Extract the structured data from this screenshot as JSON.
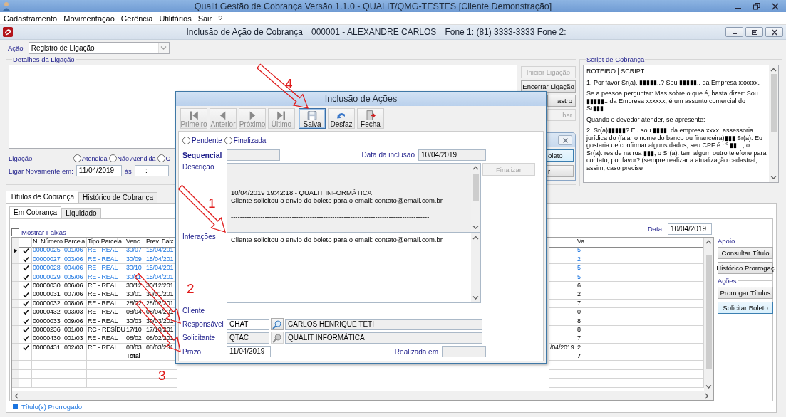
{
  "window": {
    "title": "Qualit Gestão de Cobrança Versão 1.1.0 - QUALIT/QMG-TESTES [Cliente Demonstração]"
  },
  "menu": [
    "Cadastramento",
    "Movimentação",
    "Gerência",
    "Utilitários",
    "Sair",
    "?"
  ],
  "form": {
    "title": "Inclusão de Ação de Cobrança",
    "client": "000001 - ALEXANDRE CARLOS",
    "phones": "Fone 1: (81) 3333-3333 Fone 2:"
  },
  "action": {
    "label": "Ação",
    "value": "Registro de Ligação"
  },
  "call_details": {
    "title": "Detalhes da Ligação",
    "buttons": [
      {
        "label": "Iniciar Ligação",
        "disabled": true
      },
      {
        "label": "Encerrar Ligação",
        "disabled": false
      },
      {
        "label": "astro",
        "disabled": false
      },
      {
        "label": "har",
        "disabled": true
      }
    ],
    "call_label": "Ligação",
    "call_options": [
      {
        "label": "Atendida",
        "selected": false
      },
      {
        "label": "Não Atendida",
        "selected": false
      },
      {
        "label": "O",
        "selected": false
      }
    ],
    "recall_label": "Ligar Novamente em:",
    "recall_date": "11/04/2019",
    "at_label": "às",
    "recall_time": ":"
  },
  "script": {
    "title": "Script de Cobrança",
    "paragraphs": [
      "ROTEIRO | SCRIPT",
      "1. Por favor Sr(a). ▮▮▮▮▮..? Sou ▮▮▮▮▮.. da Empresa xxxxxx.",
      "Se a pessoa perguntar: Mas sobre o que é, basta dizer: Sou ▮▮▮▮▮.. da Empresa xxxxxx, é um assunto comercial do Sr▮▮▮..",
      "Quando o devedor atender, se apresente:",
      "2. Sr(a)▮▮▮▮▮? Eu sou ▮▮▮▮. da empresa xxxx, assessoria jurídica do (falar o nome do banco ou financeira)▮▮▮ Sr(a). Eu gostaria de confirmar alguns dados, seu CPF é nº ▮▮..., o Sr(a). reside na rua ▮▮▮, o Sr(a). tem algum outro telefone para contato, por favor? (sempre realizar a atualização cadastral, assim, caso precise"
    ]
  },
  "tabs": [
    {
      "label": "Títulos de Cobrança",
      "selected": true
    },
    {
      "label": "Histórico de Cobrança",
      "selected": false
    }
  ],
  "subtabs": [
    {
      "label": "Em Cobrança",
      "selected": true
    },
    {
      "label": "Liquidado",
      "selected": false
    }
  ],
  "show_ranges": {
    "label": "Mostrar Faixas",
    "checked": false
  },
  "date": {
    "label": "Data",
    "value": "10/04/2019"
  },
  "table": {
    "columns": [
      "N. Número",
      "Parcela",
      "Tipo Parcela",
      "Venc.",
      "Prev. Baix",
      "Va"
    ],
    "rows": [
      {
        "current": true,
        "checked": true,
        "extended": true,
        "cells": [
          "00000025",
          "001/06",
          "RE - REAL",
          "30/07",
          "15/04/201"
        ],
        "va": "5"
      },
      {
        "current": false,
        "checked": true,
        "extended": true,
        "cells": [
          "00000027",
          "003/06",
          "RE - REAL",
          "30/09",
          "15/04/201"
        ],
        "va": "2"
      },
      {
        "current": false,
        "checked": true,
        "extended": true,
        "cells": [
          "00000028",
          "004/06",
          "RE - REAL",
          "30/10",
          "15/04/201"
        ],
        "va": "5"
      },
      {
        "current": false,
        "checked": true,
        "extended": true,
        "cells": [
          "00000029",
          "005/06",
          "RE - REAL",
          "30/11",
          "15/04/201"
        ],
        "va": "5"
      },
      {
        "current": false,
        "checked": true,
        "extended": false,
        "cells": [
          "00000030",
          "006/06",
          "RE - REAL",
          "30/12",
          "30/12/201"
        ],
        "va": "6"
      },
      {
        "current": false,
        "checked": true,
        "extended": false,
        "cells": [
          "00000031",
          "007/06",
          "RE - REAL",
          "30/01",
          "30/01/201"
        ],
        "va": "2"
      },
      {
        "current": false,
        "checked": true,
        "extended": false,
        "cells": [
          "00000032",
          "008/06",
          "RE - REAL",
          "28/02",
          "28/02/201"
        ],
        "va": "7"
      },
      {
        "current": false,
        "checked": true,
        "extended": false,
        "cells": [
          "00000432",
          "003/03",
          "RE - REAL",
          "08/04",
          "08/04/201"
        ],
        "va": "0"
      },
      {
        "current": false,
        "checked": true,
        "extended": false,
        "cells": [
          "00000033",
          "009/06",
          "RE - REAL",
          "30/03",
          "30/03/201"
        ],
        "va": "8"
      },
      {
        "current": false,
        "checked": true,
        "extended": false,
        "cells": [
          "00000236",
          "001/00",
          "RC - RESÍDU",
          "17/10",
          "17/10/201"
        ],
        "va": "8"
      },
      {
        "current": false,
        "checked": true,
        "extended": false,
        "cells": [
          "00000430",
          "001/03",
          "RE - REAL",
          "08/02",
          "08/02/201"
        ],
        "va": "7"
      },
      {
        "current": false,
        "checked": true,
        "extended": false,
        "cells": [
          "00000431",
          "002/03",
          "RE - REAL",
          "08/03",
          "08/03/201"
        ],
        "column_8": "/04/2019",
        "va": "2"
      }
    ],
    "total_label": "Total",
    "total_va": "7"
  },
  "side_panel": [
    {
      "title": "Apoio",
      "buttons": [
        {
          "label": "Consultar Título",
          "focused": false
        },
        {
          "label": "Histórico Prorrogaç",
          "focused": false
        }
      ]
    },
    {
      "title": "Ações",
      "buttons": [
        {
          "label": "Prorrogar Títulos",
          "focused": false
        },
        {
          "label": "Solicitar Boleto",
          "focused": true
        }
      ]
    }
  ],
  "legend": {
    "label": "Título(s) Prorrogado"
  },
  "back_dialog": {
    "buttons": [
      "oleto",
      "r"
    ]
  },
  "modal": {
    "title": "Inclusão de Ações",
    "toolbar": [
      {
        "label": "Primeiro",
        "kind": "first",
        "disabled": true,
        "focused": false
      },
      {
        "label": "Anterior",
        "kind": "prev",
        "disabled": true,
        "focused": false
      },
      {
        "label": "Próximo",
        "kind": "next",
        "disabled": true,
        "focused": false
      },
      {
        "label": "Último",
        "kind": "last",
        "disabled": true,
        "focused": false
      },
      {
        "label": "Salva",
        "kind": "save",
        "disabled": false,
        "focused": true
      },
      {
        "label": "Desfaz",
        "kind": "undo",
        "disabled": false,
        "focused": false
      },
      {
        "label": "Fecha",
        "kind": "close",
        "disabled": false,
        "focused": false
      }
    ],
    "status_options": [
      {
        "label": "Pendente",
        "selected": false
      },
      {
        "label": "Finalizada",
        "selected": false
      }
    ],
    "sequence_label": "Sequencial",
    "inclusion_date": {
      "label": "Data da inclusão",
      "value": "10/04/2019"
    },
    "description": {
      "label": "Descrição",
      "lines": [
        {
          "kind": "rule",
          "text": "----------------------------------------------------------------------------------------"
        },
        {
          "kind": "text",
          "text": "10/04/2019 19:42:18 - QUALIT INFORMÁTICA"
        },
        {
          "kind": "text",
          "text": "Cliente solicitou o envio do boleto para o email: contato@email.com.br"
        },
        {
          "kind": "rule",
          "text": "----------------------------------------------------------------------------------------"
        }
      ]
    },
    "finalize_button": {
      "label": "Finalizar",
      "disabled": true
    },
    "interactions": {
      "label": "Interações",
      "value": "Cliente solicitou o envio do boleto para o email: contato@email.com.br"
    },
    "client_label": "Cliente",
    "people": [
      {
        "label": "Responsável",
        "code": "CHAT",
        "name": "CARLOS HENRIQUE TETI",
        "disabled": false
      },
      {
        "label": "Solicitante",
        "code": "QTAC",
        "name": "QUALIT INFORMÁTICA",
        "disabled": true
      }
    ],
    "deadline": {
      "label": "Prazo",
      "value": "11/04/2019"
    },
    "done_at": {
      "label": "Realizada em"
    }
  },
  "annotations": [
    {
      "number": "4"
    },
    {
      "number": "1"
    },
    {
      "number": "2"
    },
    {
      "number": "3"
    }
  ]
}
